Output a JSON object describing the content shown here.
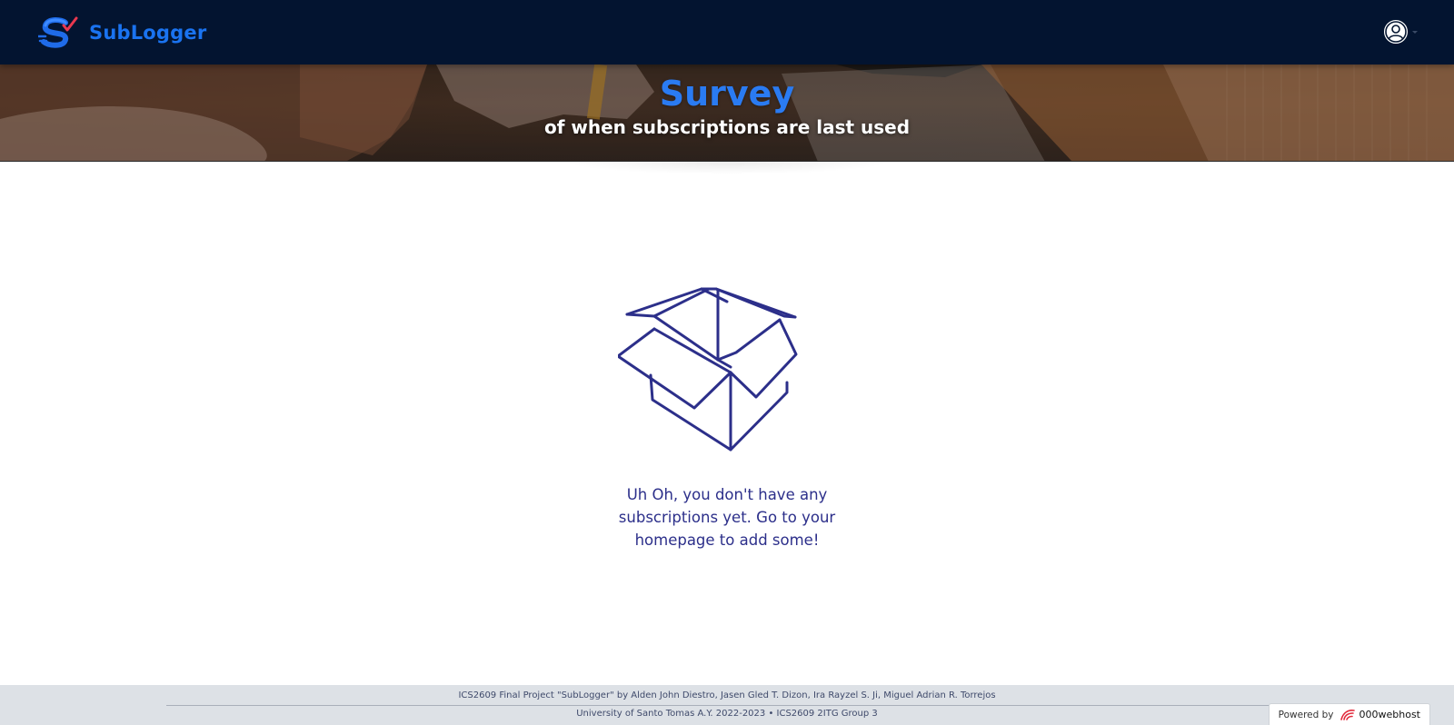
{
  "navbar": {
    "brand_name": "SubLogger",
    "brand_logo_icon": "sublogger-s-logo-icon",
    "user_icon": "user-circle-icon",
    "brand_color": "#1a73f0",
    "background_color": "#031430"
  },
  "hero": {
    "title": "Survey",
    "subtitle": "of when subscriptions are last used",
    "title_color": "#2a7bf2"
  },
  "empty_state": {
    "icon": "open-box-icon",
    "message": "Uh Oh, you don't have any subscriptions yet. Go to your homepage to add some!",
    "color": "#2c2f8a"
  },
  "footer": {
    "line1": "ICS2609 Final Project \"SubLogger\" by Alden John Diestro, Jasen Gled T. Dizon, Ira Rayzel S. Ji, Miguel Adrian R. Torrejos",
    "line2": "University of Santo Tomas A.Y. 2022-2023 • ICS2609 2ITG Group 3",
    "powered_by_label": "Powered by",
    "host_name": "000webhost",
    "host_icon": "000webhost-logo-icon"
  }
}
